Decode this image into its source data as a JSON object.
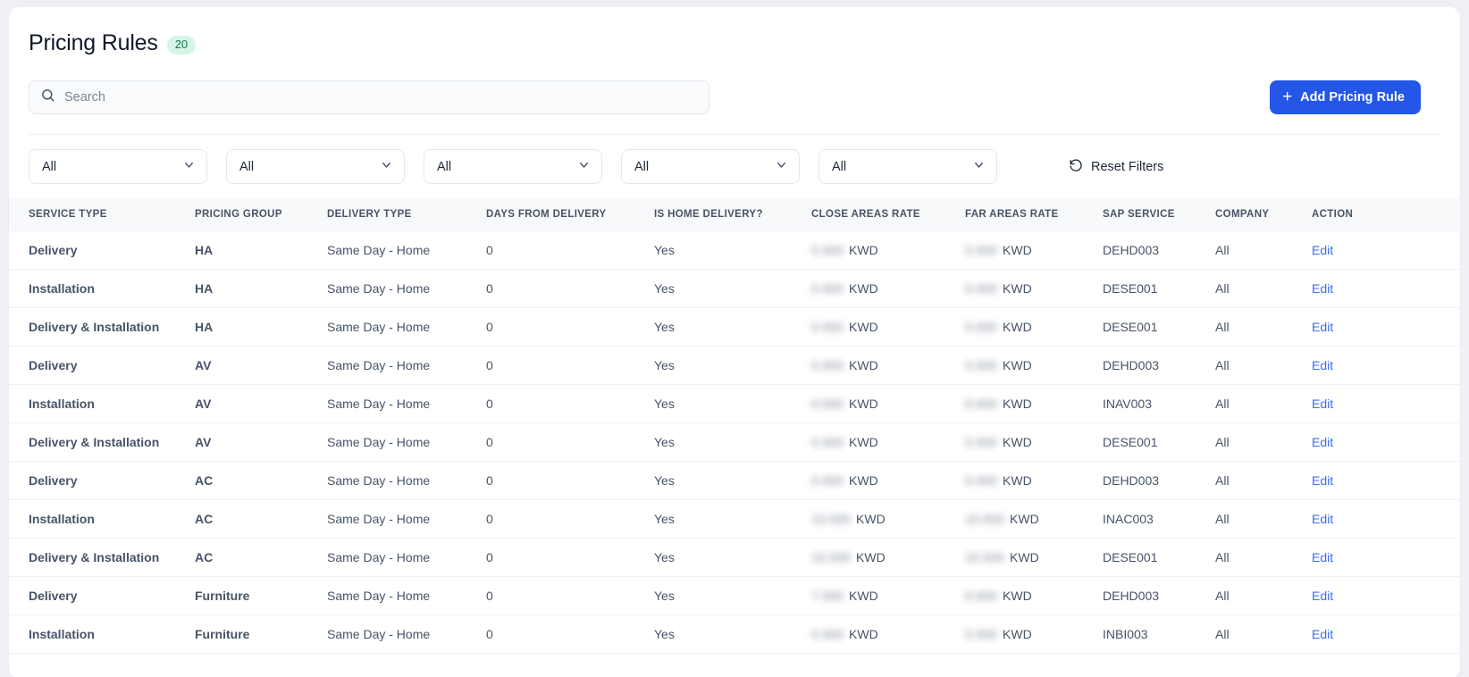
{
  "header": {
    "title": "Pricing Rules",
    "count_badge": "20",
    "badge_bg": "#d7f5e6",
    "badge_color": "#127a50"
  },
  "search": {
    "placeholder": "Search",
    "value": "",
    "icon": "search-icon"
  },
  "add_button": {
    "label": "Add Pricing Rule",
    "plus": "+",
    "color": "#2456e8"
  },
  "filters": {
    "dropdowns": [
      {
        "name": "service-type",
        "value": "All",
        "icon": "chevron-down-icon"
      },
      {
        "name": "pricing-group",
        "value": "All",
        "icon": "chevron-down-icon"
      },
      {
        "name": "delivery-type",
        "value": "All",
        "icon": "chevron-down-icon"
      },
      {
        "name": "home-delivery",
        "value": "All",
        "icon": "chevron-down-icon"
      },
      {
        "name": "company",
        "value": "All",
        "icon": "chevron-down-icon"
      }
    ],
    "reset": {
      "label": "Reset Filters",
      "icon": "rotate-ccw-icon"
    }
  },
  "table": {
    "columns": [
      "SERVICE TYPE",
      "PRICING GROUP",
      "DELIVERY TYPE",
      "DAYS FROM DELIVERY",
      "IS HOME DELIVERY?",
      "CLOSE AREAS RATE",
      "FAR AREAS RATE",
      "SAP SERVICE",
      "COMPANY",
      "ACTION"
    ],
    "currency": "KWD",
    "action_label": "Edit",
    "action_color": "#3b6df5",
    "rows": [
      {
        "service_type": "Delivery",
        "pricing_group": "HA",
        "delivery_type": "Same Day - Home",
        "days_from_delivery": "0",
        "is_home_delivery": "Yes",
        "close_areas_rate": "0.000",
        "far_areas_rate": "0.000",
        "sap_service": "DEHD003",
        "company": "All",
        "action": "Edit"
      },
      {
        "service_type": "Installation",
        "pricing_group": "HA",
        "delivery_type": "Same Day - Home",
        "days_from_delivery": "0",
        "is_home_delivery": "Yes",
        "close_areas_rate": "0.000",
        "far_areas_rate": "0.000",
        "sap_service": "DESE001",
        "company": "All",
        "action": "Edit"
      },
      {
        "service_type": "Delivery & Installation",
        "pricing_group": "HA",
        "delivery_type": "Same Day - Home",
        "days_from_delivery": "0",
        "is_home_delivery": "Yes",
        "close_areas_rate": "0.000",
        "far_areas_rate": "0.000",
        "sap_service": "DESE001",
        "company": "All",
        "action": "Edit"
      },
      {
        "service_type": "Delivery",
        "pricing_group": "AV",
        "delivery_type": "Same Day - Home",
        "days_from_delivery": "0",
        "is_home_delivery": "Yes",
        "close_areas_rate": "0.000",
        "far_areas_rate": "0.000",
        "sap_service": "DEHD003",
        "company": "All",
        "action": "Edit"
      },
      {
        "service_type": "Installation",
        "pricing_group": "AV",
        "delivery_type": "Same Day - Home",
        "days_from_delivery": "0",
        "is_home_delivery": "Yes",
        "close_areas_rate": "0.000",
        "far_areas_rate": "0.000",
        "sap_service": "INAV003",
        "company": "All",
        "action": "Edit"
      },
      {
        "service_type": "Delivery & Installation",
        "pricing_group": "AV",
        "delivery_type": "Same Day - Home",
        "days_from_delivery": "0",
        "is_home_delivery": "Yes",
        "close_areas_rate": "0.000",
        "far_areas_rate": "0.000",
        "sap_service": "DESE001",
        "company": "All",
        "action": "Edit"
      },
      {
        "service_type": "Delivery",
        "pricing_group": "AC",
        "delivery_type": "Same Day - Home",
        "days_from_delivery": "0",
        "is_home_delivery": "Yes",
        "close_areas_rate": "0.000",
        "far_areas_rate": "0.000",
        "sap_service": "DEHD003",
        "company": "All",
        "action": "Edit"
      },
      {
        "service_type": "Installation",
        "pricing_group": "AC",
        "delivery_type": "Same Day - Home",
        "days_from_delivery": "0",
        "is_home_delivery": "Yes",
        "close_areas_rate": "10.000",
        "far_areas_rate": "10.000",
        "sap_service": "INAC003",
        "company": "All",
        "action": "Edit"
      },
      {
        "service_type": "Delivery & Installation",
        "pricing_group": "AC",
        "delivery_type": "Same Day - Home",
        "days_from_delivery": "0",
        "is_home_delivery": "Yes",
        "close_areas_rate": "10.000",
        "far_areas_rate": "10.000",
        "sap_service": "DESE001",
        "company": "All",
        "action": "Edit"
      },
      {
        "service_type": "Delivery",
        "pricing_group": "Furniture",
        "delivery_type": "Same Day - Home",
        "days_from_delivery": "0",
        "is_home_delivery": "Yes",
        "close_areas_rate": "7.000",
        "far_areas_rate": "0.000",
        "sap_service": "DEHD003",
        "company": "All",
        "action": "Edit"
      },
      {
        "service_type": "Installation",
        "pricing_group": "Furniture",
        "delivery_type": "Same Day - Home",
        "days_from_delivery": "0",
        "is_home_delivery": "Yes",
        "close_areas_rate": "0.000",
        "far_areas_rate": "0.000",
        "sap_service": "INBI003",
        "company": "All",
        "action": "Edit"
      }
    ]
  }
}
